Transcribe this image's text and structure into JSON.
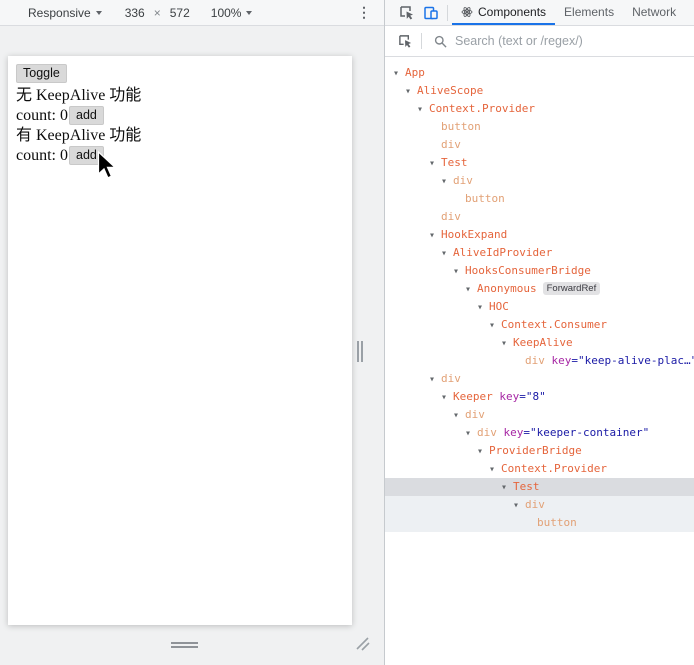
{
  "device_toolbar": {
    "mode_label": "Responsive",
    "width": "336",
    "times": "×",
    "height": "572",
    "zoom": "100%",
    "more_icon": "⋮"
  },
  "page": {
    "toggle_button": "Toggle",
    "section1_title": "无 KeepAlive 功能",
    "section1_count": "count: 0",
    "section1_add": "add",
    "section2_title": "有 KeepAlive 功能",
    "section2_count": "count: 0",
    "section2_add": "add"
  },
  "devtools": {
    "tabs": [
      {
        "label": "Components",
        "active": true
      },
      {
        "label": "Elements",
        "active": false
      },
      {
        "label": "Network",
        "active": false
      }
    ],
    "search": {
      "placeholder": "Search (text or /regex/)"
    },
    "tree": {
      "key_label": "key",
      "rows": [
        {
          "level": 0,
          "arrow": true,
          "name": "App",
          "kind": "component"
        },
        {
          "level": 1,
          "arrow": true,
          "name": "AliveScope",
          "kind": "component"
        },
        {
          "level": 2,
          "arrow": true,
          "name": "Context.Provider",
          "kind": "component"
        },
        {
          "level": 3,
          "arrow": false,
          "name": "button",
          "kind": "host"
        },
        {
          "level": 3,
          "arrow": false,
          "name": "div",
          "kind": "host"
        },
        {
          "level": 3,
          "arrow": true,
          "name": "Test",
          "kind": "component"
        },
        {
          "level": 4,
          "arrow": true,
          "name": "div",
          "kind": "host"
        },
        {
          "level": 5,
          "arrow": false,
          "name": "button",
          "kind": "host"
        },
        {
          "level": 3,
          "arrow": false,
          "name": "div",
          "kind": "host"
        },
        {
          "level": 3,
          "arrow": true,
          "name": "HookExpand",
          "kind": "component"
        },
        {
          "level": 4,
          "arrow": true,
          "name": "AliveIdProvider",
          "kind": "component"
        },
        {
          "level": 5,
          "arrow": true,
          "name": "HooksConsumerBridge",
          "kind": "component"
        },
        {
          "level": 6,
          "arrow": true,
          "name": "Anonymous",
          "kind": "component",
          "badge": "ForwardRef"
        },
        {
          "level": 7,
          "arrow": true,
          "name": "HOC",
          "kind": "component"
        },
        {
          "level": 8,
          "arrow": true,
          "name": "Context.Consumer",
          "kind": "component"
        },
        {
          "level": 9,
          "arrow": true,
          "name": "KeepAlive",
          "kind": "component"
        },
        {
          "level": 10,
          "arrow": false,
          "name": "div",
          "kind": "host",
          "key": "keep-alive-plac…"
        },
        {
          "level": 3,
          "arrow": true,
          "name": "div",
          "kind": "host"
        },
        {
          "level": 4,
          "arrow": true,
          "name": "Keeper",
          "kind": "component",
          "key": "8"
        },
        {
          "level": 5,
          "arrow": true,
          "name": "div",
          "kind": "host"
        },
        {
          "level": 6,
          "arrow": true,
          "name": "div",
          "kind": "host",
          "key": "keeper-container"
        },
        {
          "level": 7,
          "arrow": true,
          "name": "ProviderBridge",
          "kind": "component"
        },
        {
          "level": 8,
          "arrow": true,
          "name": "Context.Provider",
          "kind": "component"
        },
        {
          "level": 9,
          "arrow": true,
          "name": "Test",
          "kind": "component",
          "state": "selected"
        },
        {
          "level": 10,
          "arrow": true,
          "name": "div",
          "kind": "host",
          "state": "subtree"
        },
        {
          "level": 11,
          "arrow": false,
          "name": "button",
          "kind": "host",
          "state": "subtree"
        }
      ]
    },
    "colors": {
      "accent_blue": "#1a73e8",
      "component_name": "#e5653c",
      "host_element_name": "#e2a176",
      "key_name": "#a626a4",
      "key_value": "#1a1aa6",
      "selected_row_bg": "#dadce0",
      "selected_subtree_bg": "#edf0f3"
    }
  }
}
